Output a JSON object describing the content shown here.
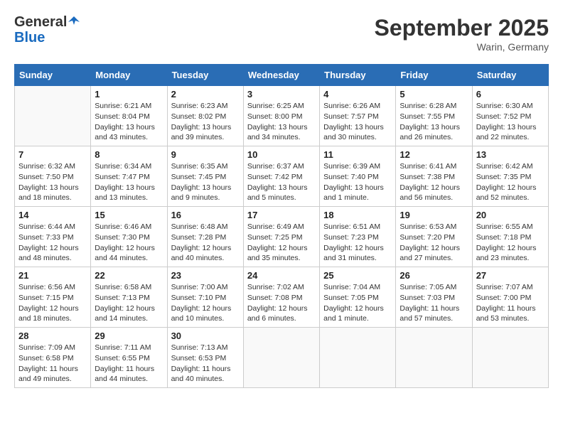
{
  "header": {
    "logo_general": "General",
    "logo_blue": "Blue",
    "month_title": "September 2025",
    "location": "Warin, Germany"
  },
  "weekdays": [
    "Sunday",
    "Monday",
    "Tuesday",
    "Wednesday",
    "Thursday",
    "Friday",
    "Saturday"
  ],
  "weeks": [
    [
      {
        "day": "",
        "sunrise": "",
        "sunset": "",
        "daylight": ""
      },
      {
        "day": "1",
        "sunrise": "Sunrise: 6:21 AM",
        "sunset": "Sunset: 8:04 PM",
        "daylight": "Daylight: 13 hours and 43 minutes."
      },
      {
        "day": "2",
        "sunrise": "Sunrise: 6:23 AM",
        "sunset": "Sunset: 8:02 PM",
        "daylight": "Daylight: 13 hours and 39 minutes."
      },
      {
        "day": "3",
        "sunrise": "Sunrise: 6:25 AM",
        "sunset": "Sunset: 8:00 PM",
        "daylight": "Daylight: 13 hours and 34 minutes."
      },
      {
        "day": "4",
        "sunrise": "Sunrise: 6:26 AM",
        "sunset": "Sunset: 7:57 PM",
        "daylight": "Daylight: 13 hours and 30 minutes."
      },
      {
        "day": "5",
        "sunrise": "Sunrise: 6:28 AM",
        "sunset": "Sunset: 7:55 PM",
        "daylight": "Daylight: 13 hours and 26 minutes."
      },
      {
        "day": "6",
        "sunrise": "Sunrise: 6:30 AM",
        "sunset": "Sunset: 7:52 PM",
        "daylight": "Daylight: 13 hours and 22 minutes."
      }
    ],
    [
      {
        "day": "7",
        "sunrise": "Sunrise: 6:32 AM",
        "sunset": "Sunset: 7:50 PM",
        "daylight": "Daylight: 13 hours and 18 minutes."
      },
      {
        "day": "8",
        "sunrise": "Sunrise: 6:34 AM",
        "sunset": "Sunset: 7:47 PM",
        "daylight": "Daylight: 13 hours and 13 minutes."
      },
      {
        "day": "9",
        "sunrise": "Sunrise: 6:35 AM",
        "sunset": "Sunset: 7:45 PM",
        "daylight": "Daylight: 13 hours and 9 minutes."
      },
      {
        "day": "10",
        "sunrise": "Sunrise: 6:37 AM",
        "sunset": "Sunset: 7:42 PM",
        "daylight": "Daylight: 13 hours and 5 minutes."
      },
      {
        "day": "11",
        "sunrise": "Sunrise: 6:39 AM",
        "sunset": "Sunset: 7:40 PM",
        "daylight": "Daylight: 13 hours and 1 minute."
      },
      {
        "day": "12",
        "sunrise": "Sunrise: 6:41 AM",
        "sunset": "Sunset: 7:38 PM",
        "daylight": "Daylight: 12 hours and 56 minutes."
      },
      {
        "day": "13",
        "sunrise": "Sunrise: 6:42 AM",
        "sunset": "Sunset: 7:35 PM",
        "daylight": "Daylight: 12 hours and 52 minutes."
      }
    ],
    [
      {
        "day": "14",
        "sunrise": "Sunrise: 6:44 AM",
        "sunset": "Sunset: 7:33 PM",
        "daylight": "Daylight: 12 hours and 48 minutes."
      },
      {
        "day": "15",
        "sunrise": "Sunrise: 6:46 AM",
        "sunset": "Sunset: 7:30 PM",
        "daylight": "Daylight: 12 hours and 44 minutes."
      },
      {
        "day": "16",
        "sunrise": "Sunrise: 6:48 AM",
        "sunset": "Sunset: 7:28 PM",
        "daylight": "Daylight: 12 hours and 40 minutes."
      },
      {
        "day": "17",
        "sunrise": "Sunrise: 6:49 AM",
        "sunset": "Sunset: 7:25 PM",
        "daylight": "Daylight: 12 hours and 35 minutes."
      },
      {
        "day": "18",
        "sunrise": "Sunrise: 6:51 AM",
        "sunset": "Sunset: 7:23 PM",
        "daylight": "Daylight: 12 hours and 31 minutes."
      },
      {
        "day": "19",
        "sunrise": "Sunrise: 6:53 AM",
        "sunset": "Sunset: 7:20 PM",
        "daylight": "Daylight: 12 hours and 27 minutes."
      },
      {
        "day": "20",
        "sunrise": "Sunrise: 6:55 AM",
        "sunset": "Sunset: 7:18 PM",
        "daylight": "Daylight: 12 hours and 23 minutes."
      }
    ],
    [
      {
        "day": "21",
        "sunrise": "Sunrise: 6:56 AM",
        "sunset": "Sunset: 7:15 PM",
        "daylight": "Daylight: 12 hours and 18 minutes."
      },
      {
        "day": "22",
        "sunrise": "Sunrise: 6:58 AM",
        "sunset": "Sunset: 7:13 PM",
        "daylight": "Daylight: 12 hours and 14 minutes."
      },
      {
        "day": "23",
        "sunrise": "Sunrise: 7:00 AM",
        "sunset": "Sunset: 7:10 PM",
        "daylight": "Daylight: 12 hours and 10 minutes."
      },
      {
        "day": "24",
        "sunrise": "Sunrise: 7:02 AM",
        "sunset": "Sunset: 7:08 PM",
        "daylight": "Daylight: 12 hours and 6 minutes."
      },
      {
        "day": "25",
        "sunrise": "Sunrise: 7:04 AM",
        "sunset": "Sunset: 7:05 PM",
        "daylight": "Daylight: 12 hours and 1 minute."
      },
      {
        "day": "26",
        "sunrise": "Sunrise: 7:05 AM",
        "sunset": "Sunset: 7:03 PM",
        "daylight": "Daylight: 11 hours and 57 minutes."
      },
      {
        "day": "27",
        "sunrise": "Sunrise: 7:07 AM",
        "sunset": "Sunset: 7:00 PM",
        "daylight": "Daylight: 11 hours and 53 minutes."
      }
    ],
    [
      {
        "day": "28",
        "sunrise": "Sunrise: 7:09 AM",
        "sunset": "Sunset: 6:58 PM",
        "daylight": "Daylight: 11 hours and 49 minutes."
      },
      {
        "day": "29",
        "sunrise": "Sunrise: 7:11 AM",
        "sunset": "Sunset: 6:55 PM",
        "daylight": "Daylight: 11 hours and 44 minutes."
      },
      {
        "day": "30",
        "sunrise": "Sunrise: 7:13 AM",
        "sunset": "Sunset: 6:53 PM",
        "daylight": "Daylight: 11 hours and 40 minutes."
      },
      {
        "day": "",
        "sunrise": "",
        "sunset": "",
        "daylight": ""
      },
      {
        "day": "",
        "sunrise": "",
        "sunset": "",
        "daylight": ""
      },
      {
        "day": "",
        "sunrise": "",
        "sunset": "",
        "daylight": ""
      },
      {
        "day": "",
        "sunrise": "",
        "sunset": "",
        "daylight": ""
      }
    ]
  ]
}
